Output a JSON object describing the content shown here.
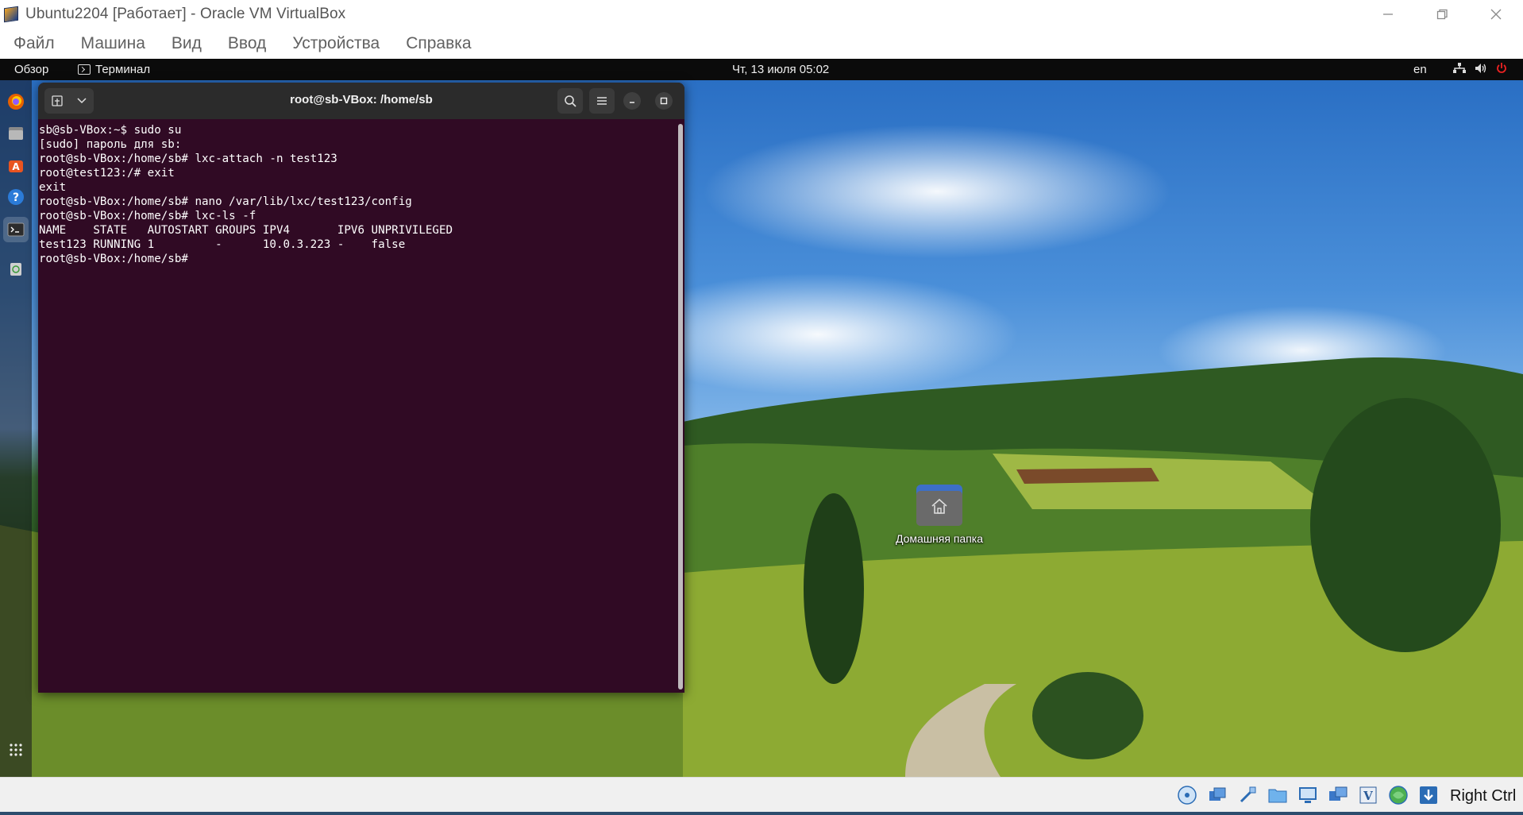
{
  "window": {
    "title": "Ubuntu2204 [Работает] - Oracle VM VirtualBox",
    "app_icon": "virtualbox-icon"
  },
  "menubar": {
    "items": [
      "Файл",
      "Машина",
      "Вид",
      "Ввод",
      "Устройства",
      "Справка"
    ]
  },
  "gnome_topbar": {
    "overview": "Обзор",
    "app_name": "Терминал",
    "clock": "Чт, 13 июля  05:02",
    "lang": "en",
    "tray_icons": [
      "network-icon",
      "volume-icon",
      "power-icon"
    ]
  },
  "dock": {
    "items": [
      "firefox-icon",
      "files-icon",
      "software-store-icon",
      "help-icon",
      "terminal-icon",
      "trash-icon"
    ],
    "apps_grid": "show-apps-icon"
  },
  "desktop": {
    "home_folder_label": "Домашняя папка"
  },
  "terminal": {
    "title": "root@sb-VBox: /home/sb",
    "lines": [
      "sb@sb-VBox:~$ sudo su",
      "[sudo] пароль для sb:",
      "root@sb-VBox:/home/sb# lxc-attach -n test123",
      "root@test123:/# exit",
      "exit",
      "root@sb-VBox:/home/sb# nano /var/lib/lxc/test123/config",
      "root@sb-VBox:/home/sb# lxc-ls -f",
      "NAME    STATE   AUTOSTART GROUPS IPV4       IPV6 UNPRIVILEGED",
      "test123 RUNNING 1         -      10.0.3.223 -    false",
      "root@sb-VBox:/home/sb# "
    ],
    "colors": {
      "background": "#300a24",
      "header": "#2b2b2b",
      "text": "#ffffff"
    }
  },
  "statusbar": {
    "icons": [
      "optical-drive-icon",
      "network-icon",
      "usb-icon",
      "shared-folders-icon",
      "display-icon",
      "recording-icon",
      "virtualization-icon",
      "mouse-integration-icon",
      "keyboard-capture-icon"
    ],
    "host_key": "Right Ctrl"
  }
}
